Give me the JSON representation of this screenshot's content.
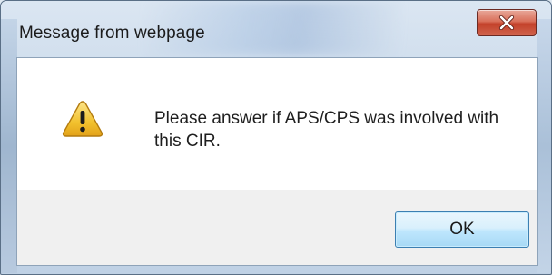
{
  "dialog": {
    "title": "Message from webpage",
    "message": "Please answer if  APS/CPS was involved with this CIR.",
    "icon": "warning-icon",
    "ok_label": "OK",
    "close_icon": "close-icon"
  },
  "colors": {
    "close_button": "#c3412a",
    "warning_fill": "#f2c12e",
    "ok_border": "#3c7fb1"
  }
}
